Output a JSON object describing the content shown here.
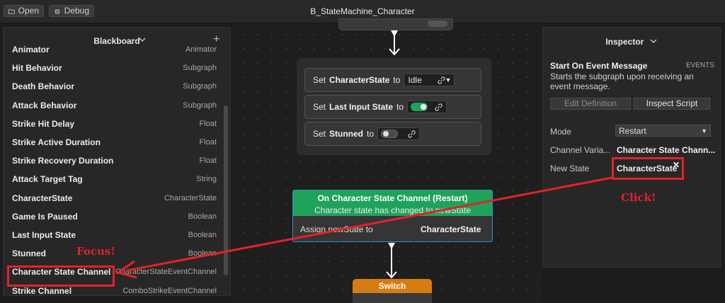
{
  "toolbar": {
    "open_label": "Open",
    "debug_label": "Debug"
  },
  "window": {
    "title": "B_StateMachine_Character"
  },
  "blackboard": {
    "title": "Blackboard",
    "add_icon": "+",
    "items": [
      {
        "name": "Animator",
        "type": "Animator"
      },
      {
        "name": "Hit Behavior",
        "type": "Subgraph"
      },
      {
        "name": "Death Behavior",
        "type": "Subgraph"
      },
      {
        "name": "Attack Behavior",
        "type": "Subgraph"
      },
      {
        "name": "Strike Hit Delay",
        "type": "Float"
      },
      {
        "name": "Strike Active Duration",
        "type": "Float"
      },
      {
        "name": "Strike Recovery Duration",
        "type": "Float"
      },
      {
        "name": "Attack Target Tag",
        "type": "String"
      },
      {
        "name": "CharacterState",
        "type": "CharacterState"
      },
      {
        "name": "Game Is Paused",
        "type": "Boolean"
      },
      {
        "name": "Last Input State",
        "type": "Boolean"
      },
      {
        "name": "Stunned",
        "type": "Boolean"
      },
      {
        "name": "Character State Channel",
        "type": "CharacterStateEventChannel"
      },
      {
        "name": "Strike Channel",
        "type": "ComboStrikeEventChannel"
      }
    ]
  },
  "graph": {
    "set_nodes": [
      {
        "verb": "Set",
        "target": "CharacterState",
        "to": "to",
        "value": "Idle"
      },
      {
        "verb": "Set",
        "target": "Last Input State",
        "to": "to",
        "value_on": true
      },
      {
        "verb": "Set",
        "target": "Stunned",
        "to": "to",
        "value_on": false
      }
    ],
    "event_node": {
      "title": "On Character State Channel (Restart)",
      "subtitle": "Character state has changed to newState",
      "assign_label": "Assign newState to",
      "assign_value": "CharacterState"
    },
    "switch_node": {
      "title": "Switch"
    }
  },
  "inspector": {
    "title": "Inspector",
    "node_title": "Start On Event Message",
    "category": "EVENTS",
    "description": "Starts the subgraph upon receiving an event message.",
    "edit_button": "Edit Definition",
    "inspect_button": "Inspect Script",
    "fields": {
      "mode_label": "Mode",
      "mode_value": "Restart",
      "channel_label": "Channel Varia...",
      "channel_value": "Character State Chann...",
      "newstate_label": "New State",
      "newstate_value": "CharacterState"
    }
  },
  "annotations": {
    "click_text": "Click!",
    "focus_text": "Focus!"
  },
  "colors": {
    "accent_green": "#1fa35a",
    "switch_orange": "#d77c12",
    "annotation_red": "#e2222b",
    "selection_blue": "#2f8fd8"
  }
}
